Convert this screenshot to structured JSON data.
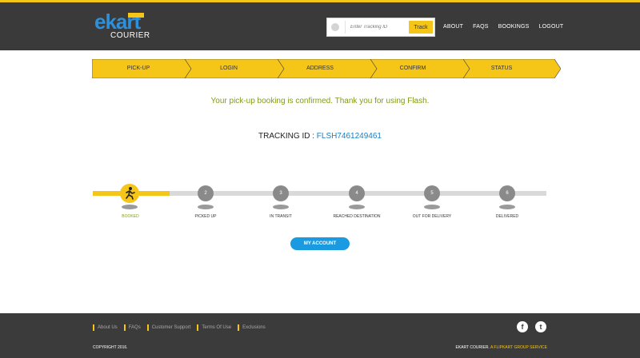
{
  "header": {
    "logo": {
      "brand": "ekart",
      "sub": "COURIER"
    },
    "track": {
      "placeholder": "Enter Tracking ID",
      "button": "Track"
    },
    "nav": [
      "ABOUT",
      "FAQS",
      "BOOKINGS",
      "LOGOUT"
    ]
  },
  "steps": [
    "PICK-UP",
    "LOGIN",
    "ADDRESS",
    "CONFIRM",
    "STATUS"
  ],
  "message": "Your pick-up booking is confirmed. Thank you for using Flash.",
  "tracking": {
    "label": "TRACKING ID :",
    "id": "FLSH7461249461"
  },
  "progress": {
    "fraction": 0.17,
    "nodes": [
      {
        "num": "",
        "label": "BOOKED",
        "active": true
      },
      {
        "num": "2",
        "label": "PICKED UP",
        "active": false
      },
      {
        "num": "3",
        "label": "IN TRANSIT",
        "active": false
      },
      {
        "num": "4",
        "label": "REACHED DESTINATION",
        "active": false
      },
      {
        "num": "5",
        "label": "OUT FOR DELIVERY",
        "active": false
      },
      {
        "num": "6",
        "label": "DELIVERED",
        "active": false
      }
    ]
  },
  "account_button": "MY ACCOUNT",
  "footer": {
    "links": [
      "About Us",
      "FAQs",
      "Customer Support",
      "Terms Of Use",
      "Exclusions"
    ],
    "social": {
      "facebook": "f",
      "twitter": "t"
    },
    "copyright": "COPYRIGHT 2016.",
    "group_prefix": "EKART COURIER.",
    "group_suffix": "A FLIPKART GROUP SERVICE"
  },
  "colors": {
    "accent": "#f5c518",
    "header": "#3a3a3a",
    "link": "#1b7ec2",
    "success": "#7f9c18"
  }
}
